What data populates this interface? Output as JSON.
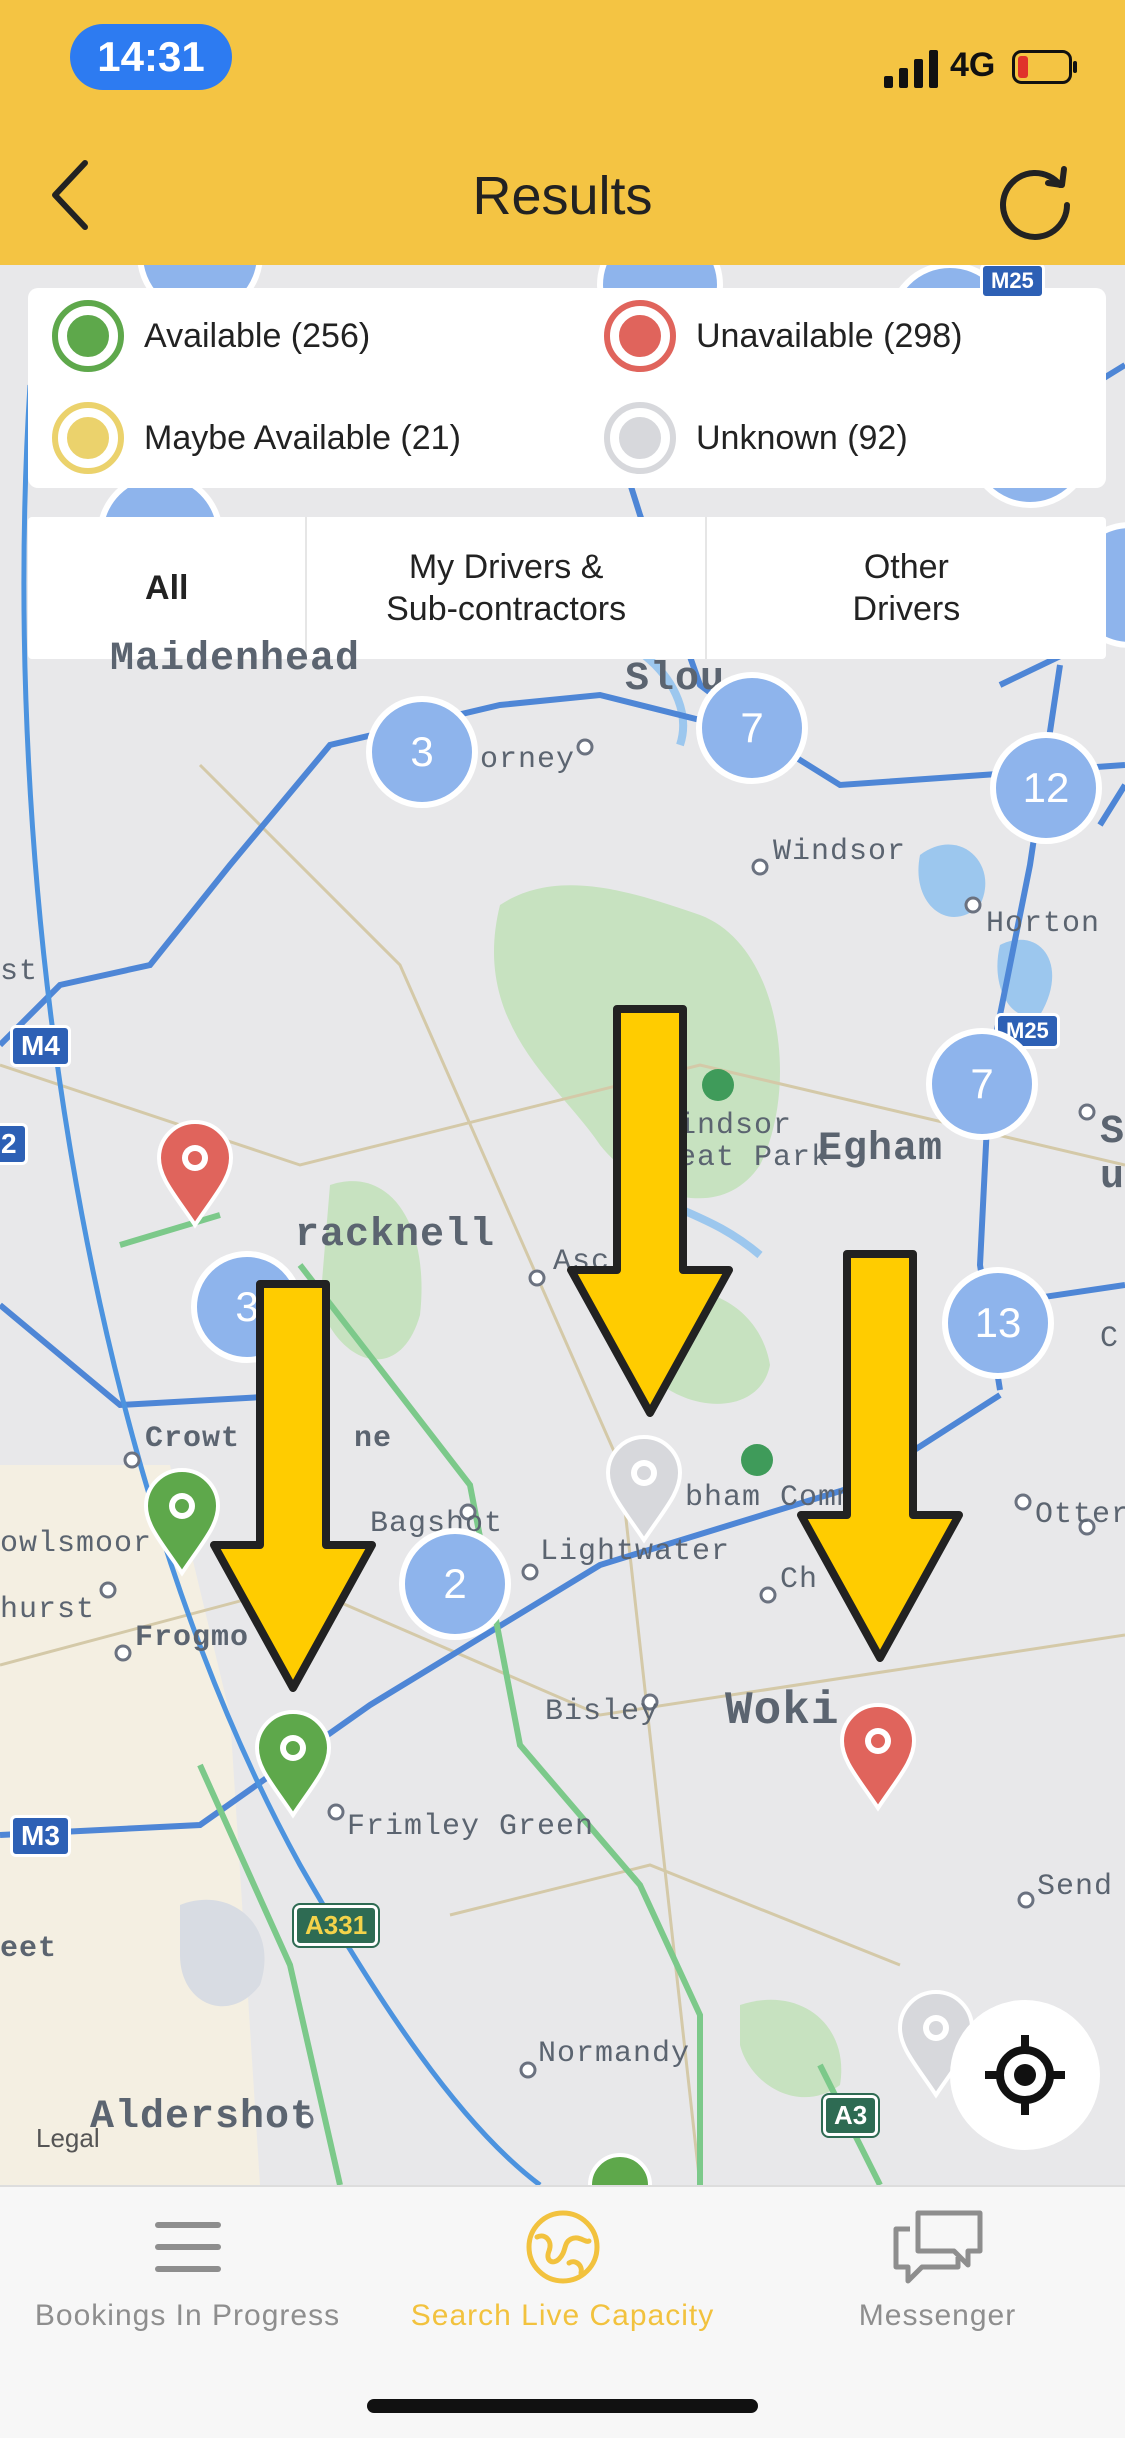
{
  "status": {
    "time": "14:31",
    "network": "4G"
  },
  "nav": {
    "title": "Results"
  },
  "legend": [
    {
      "label": "Available (256)",
      "color": "#5EA84B"
    },
    {
      "label": "Unavailable (298)",
      "color": "#E0645C"
    },
    {
      "label": "Maybe Available (21)",
      "color": "#EBD26C"
    },
    {
      "label": "Unknown (92)",
      "color": "#D7D8DC"
    }
  ],
  "filters": [
    {
      "label": "All"
    },
    {
      "label": "My Drivers &\nSub-contractors"
    },
    {
      "label": "Other\nDrivers"
    }
  ],
  "clusters": [
    "3",
    "7",
    "12",
    "7",
    "3",
    "13",
    "2"
  ],
  "places": {
    "maidenhead": "Maidenhead",
    "slough": "Slou",
    "bray": "orney",
    "windsor": "Windsor",
    "horton": "Horton",
    "windsor_park": "indsor\neat Park",
    "egham": "Egham",
    "bracknell": "racknell",
    "ascot": "Asc",
    "crowthorne": "Crowt      ne",
    "bagshot": "Bagshot",
    "lightwater": "Lightwater",
    "chobham": "bham Comm",
    "owlsmoor": "owlsmoor",
    "sandhurst": "hurst",
    "frogmore": "Frogmo",
    "bisley": "Bisley",
    "woking": "Woki",
    "frimley": "Frimley Green",
    "send": "Send",
    "otters": "Otters",
    "normandy": "Normandy",
    "aldershot": "Aldershot",
    "fleet": "eet",
    "st": "st",
    "ch": "Ch",
    "c_right": "C",
    "s_right": "S",
    "u_right": "u"
  },
  "roads": {
    "m4": "M4",
    "m3": "M3",
    "m25a": "M25",
    "m25b": "M25",
    "a331": "A331",
    "a3": "A3",
    "partial_2": "2"
  },
  "map_legal": "Legal",
  "tabs": [
    {
      "label": "Bookings In Progress"
    },
    {
      "label": "Search Live Capacity"
    },
    {
      "label": "Messenger"
    }
  ],
  "colors": {
    "accent": "#F4C443",
    "available": "#5EA84B",
    "unavailable": "#E0645C",
    "unknown": "#D7D8DC",
    "cluster": "#8EB4EC",
    "arrow": "#FFCC00"
  }
}
